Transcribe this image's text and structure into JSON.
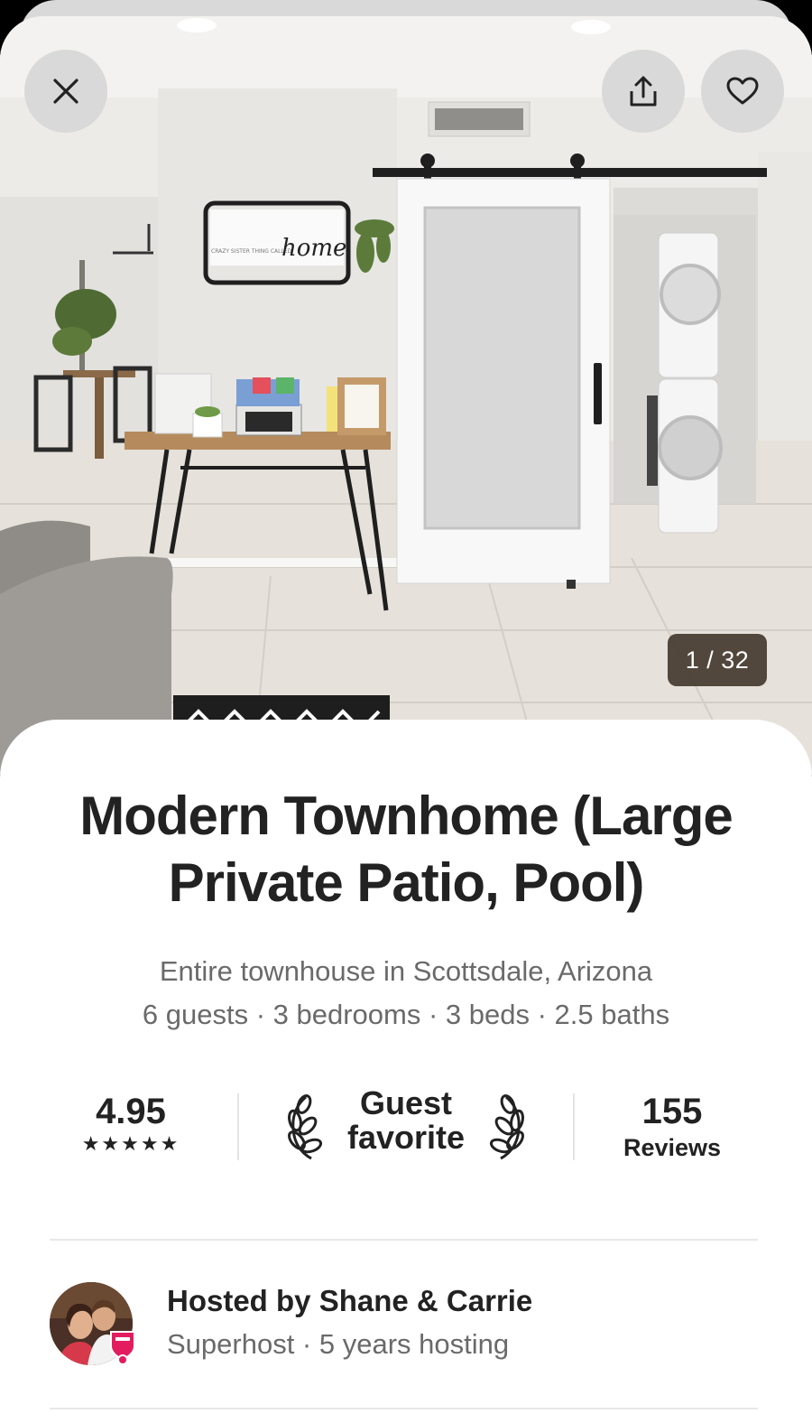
{
  "photo": {
    "counter": "1 / 32",
    "sign_text": "home",
    "sign_small_text": "CRAZY SISTER THING CALLED"
  },
  "actions": {
    "close_icon": "close-icon",
    "share_icon": "share-icon",
    "favorite_icon": "heart-icon"
  },
  "listing": {
    "title": "Modern Townhome (Large Private Patio, Pool)",
    "type_location": "Entire townhouse in Scottsdale, Arizona",
    "details": "6 guests · 3 bedrooms · 3 beds · 2.5 baths"
  },
  "stats": {
    "rating": "4.95",
    "stars": "★★★★★",
    "badge_line1": "Guest",
    "badge_line2": "favorite",
    "reviews_count": "155",
    "reviews_label": "Reviews"
  },
  "host": {
    "name": "Hosted by Shane & Carrie",
    "meta": "Superhost · 5 years hosting"
  },
  "colors": {
    "brand": "#E31C5F",
    "counter_bg": "#4A3E34",
    "text_primary": "#222222",
    "text_secondary": "#6A6A6A"
  }
}
